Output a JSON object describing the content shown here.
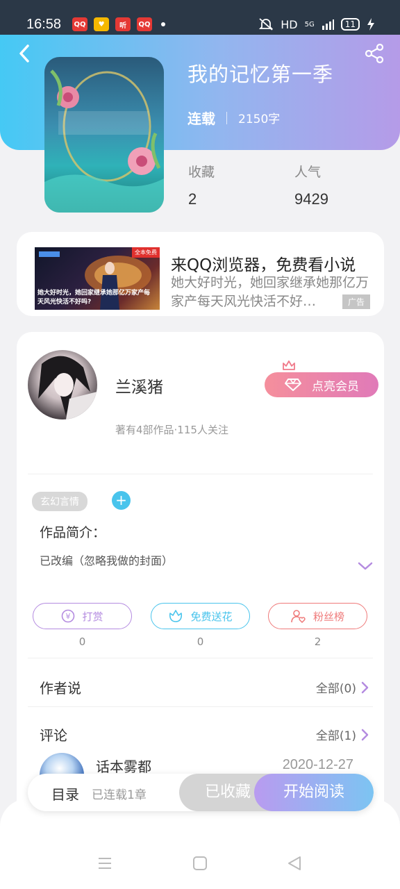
{
  "status_bar": {
    "time": "16:58",
    "apps": [
      {
        "name": "qq-reader-icon",
        "label": "QQ",
        "color": "#e53935"
      },
      {
        "name": "ticket-app-icon",
        "label": "♥",
        "color": "#f5b800"
      },
      {
        "name": "ting-app-icon",
        "label": "听",
        "color": "#e53935"
      },
      {
        "name": "qq-reader-icon-2",
        "label": "QQ",
        "color": "#e53935"
      }
    ],
    "hd": "HD",
    "network": "5G",
    "battery": "11"
  },
  "book": {
    "title": "我的记忆第一季",
    "status": "连载",
    "word_count": "2150字",
    "stats": [
      {
        "label": "收藏",
        "value": "2"
      },
      {
        "label": "人气",
        "value": "9429"
      }
    ]
  },
  "ad": {
    "title": "来QQ浏览器，免费看小说",
    "description": "她大好时光，她回家继承她那亿万家产每天风光快活不好…",
    "tag": "广告",
    "image_caption": "她大好时光，她回家继承她那亿万家产每天风光快活不好吗?",
    "image_badge": "全本免费"
  },
  "author": {
    "name": "兰溪猪",
    "stats": "著有4部作品·115人关注",
    "vip_label": "点亮会员"
  },
  "work": {
    "genre": "玄幻言情",
    "add_tag": "+",
    "intro_heading": "作品简介：",
    "intro_text": "已改编（忽略我做的封面）"
  },
  "actions": [
    {
      "label": "打赏",
      "count": "0",
      "color": "#b48be0"
    },
    {
      "label": "免费送花",
      "count": "0",
      "color": "#49c4ec"
    },
    {
      "label": "粉丝榜",
      "count": "2",
      "color": "#ef7a7a"
    }
  ],
  "author_says": {
    "title": "作者说",
    "link": "全部(0)"
  },
  "comments": {
    "title": "评论",
    "link": "全部(1)",
    "items": [
      {
        "user": "话本雾都",
        "date": "2020-12-27"
      }
    ]
  },
  "bottom_bar": {
    "toc": "目录",
    "chapters": "已连载1章",
    "collected": "已收藏",
    "read": "开始阅读"
  },
  "colors": {
    "accent": "#49c4ec",
    "purple": "#b48be0"
  }
}
